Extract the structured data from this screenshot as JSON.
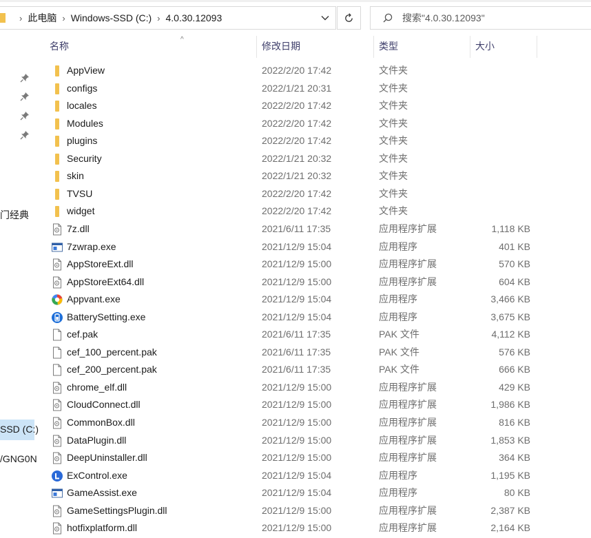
{
  "breadcrumb": {
    "items": [
      "此电脑",
      "Windows-SSD (C:)",
      "4.0.30.12093"
    ],
    "separator_glyph": "›"
  },
  "search": {
    "placeholder": "搜索\"4.0.30.12093\""
  },
  "nav": {
    "labels": [
      "门经典",
      "SSD (C:)",
      "/GNG0N"
    ]
  },
  "columns": {
    "name": "名称",
    "date": "修改日期",
    "type": "类型",
    "size": "大小"
  },
  "sort_indicator": "^",
  "files": [
    {
      "name": "AppView",
      "date": "2022/2/20 17:42",
      "type": "文件夹",
      "size": "",
      "icon": "folder-icon"
    },
    {
      "name": "configs",
      "date": "2022/1/21 20:31",
      "type": "文件夹",
      "size": "",
      "icon": "folder-icon"
    },
    {
      "name": "locales",
      "date": "2022/2/20 17:42",
      "type": "文件夹",
      "size": "",
      "icon": "folder-icon"
    },
    {
      "name": "Modules",
      "date": "2022/2/20 17:42",
      "type": "文件夹",
      "size": "",
      "icon": "folder-icon"
    },
    {
      "name": "plugins",
      "date": "2022/2/20 17:42",
      "type": "文件夹",
      "size": "",
      "icon": "folder-icon"
    },
    {
      "name": "Security",
      "date": "2022/1/21 20:32",
      "type": "文件夹",
      "size": "",
      "icon": "folder-icon"
    },
    {
      "name": "skin",
      "date": "2022/1/21 20:32",
      "type": "文件夹",
      "size": "",
      "icon": "folder-icon"
    },
    {
      "name": "TVSU",
      "date": "2022/2/20 17:42",
      "type": "文件夹",
      "size": "",
      "icon": "folder-icon"
    },
    {
      "name": "widget",
      "date": "2022/2/20 17:42",
      "type": "文件夹",
      "size": "",
      "icon": "folder-icon"
    },
    {
      "name": "7z.dll",
      "date": "2021/6/11 17:35",
      "type": "应用程序扩展",
      "size": "1,118 KB",
      "icon": "dll-icon"
    },
    {
      "name": "7zwrap.exe",
      "date": "2021/12/9 15:04",
      "type": "应用程序",
      "size": "401 KB",
      "icon": "exe-window-icon"
    },
    {
      "name": "AppStoreExt.dll",
      "date": "2021/12/9 15:00",
      "type": "应用程序扩展",
      "size": "570 KB",
      "icon": "dll-icon"
    },
    {
      "name": "AppStoreExt64.dll",
      "date": "2021/12/9 15:00",
      "type": "应用程序扩展",
      "size": "604 KB",
      "icon": "dll-icon"
    },
    {
      "name": "Appvant.exe",
      "date": "2021/12/9 15:04",
      "type": "应用程序",
      "size": "3,466 KB",
      "icon": "appvant-icon"
    },
    {
      "name": "BatterySetting.exe",
      "date": "2021/12/9 15:04",
      "type": "应用程序",
      "size": "3,675 KB",
      "icon": "battery-icon"
    },
    {
      "name": "cef.pak",
      "date": "2021/6/11 17:35",
      "type": "PAK 文件",
      "size": "4,112 KB",
      "icon": "file-icon"
    },
    {
      "name": "cef_100_percent.pak",
      "date": "2021/6/11 17:35",
      "type": "PAK 文件",
      "size": "576 KB",
      "icon": "file-icon"
    },
    {
      "name": "cef_200_percent.pak",
      "date": "2021/6/11 17:35",
      "type": "PAK 文件",
      "size": "666 KB",
      "icon": "file-icon"
    },
    {
      "name": "chrome_elf.dll",
      "date": "2021/12/9 15:00",
      "type": "应用程序扩展",
      "size": "429 KB",
      "icon": "dll-icon"
    },
    {
      "name": "CloudConnect.dll",
      "date": "2021/12/9 15:00",
      "type": "应用程序扩展",
      "size": "1,986 KB",
      "icon": "dll-icon"
    },
    {
      "name": "CommonBox.dll",
      "date": "2021/12/9 15:00",
      "type": "应用程序扩展",
      "size": "816 KB",
      "icon": "dll-icon"
    },
    {
      "name": "DataPlugin.dll",
      "date": "2021/12/9 15:00",
      "type": "应用程序扩展",
      "size": "1,853 KB",
      "icon": "dll-icon"
    },
    {
      "name": "DeepUninstaller.dll",
      "date": "2021/12/9 15:00",
      "type": "应用程序扩展",
      "size": "364 KB",
      "icon": "dll-icon"
    },
    {
      "name": "ExControl.exe",
      "date": "2021/12/9 15:04",
      "type": "应用程序",
      "size": "1,195 KB",
      "icon": "excontrol-icon"
    },
    {
      "name": "GameAssist.exe",
      "date": "2021/12/9 15:04",
      "type": "应用程序",
      "size": "80 KB",
      "icon": "exe-window-icon"
    },
    {
      "name": "GameSettingsPlugin.dll",
      "date": "2021/12/9 15:00",
      "type": "应用程序扩展",
      "size": "2,387 KB",
      "icon": "dll-icon"
    },
    {
      "name": "hotfixplatform.dll",
      "date": "2021/12/9 15:00",
      "type": "应用程序扩展",
      "size": "2,164 KB",
      "icon": "dll-icon"
    }
  ],
  "colors": {
    "folder": "#f2c14e",
    "nav_selected": "#cce4f7",
    "header_text": "#3e3e6a",
    "detail_text": "#6d6d6d",
    "accent_blue": "#1e6fd9"
  }
}
